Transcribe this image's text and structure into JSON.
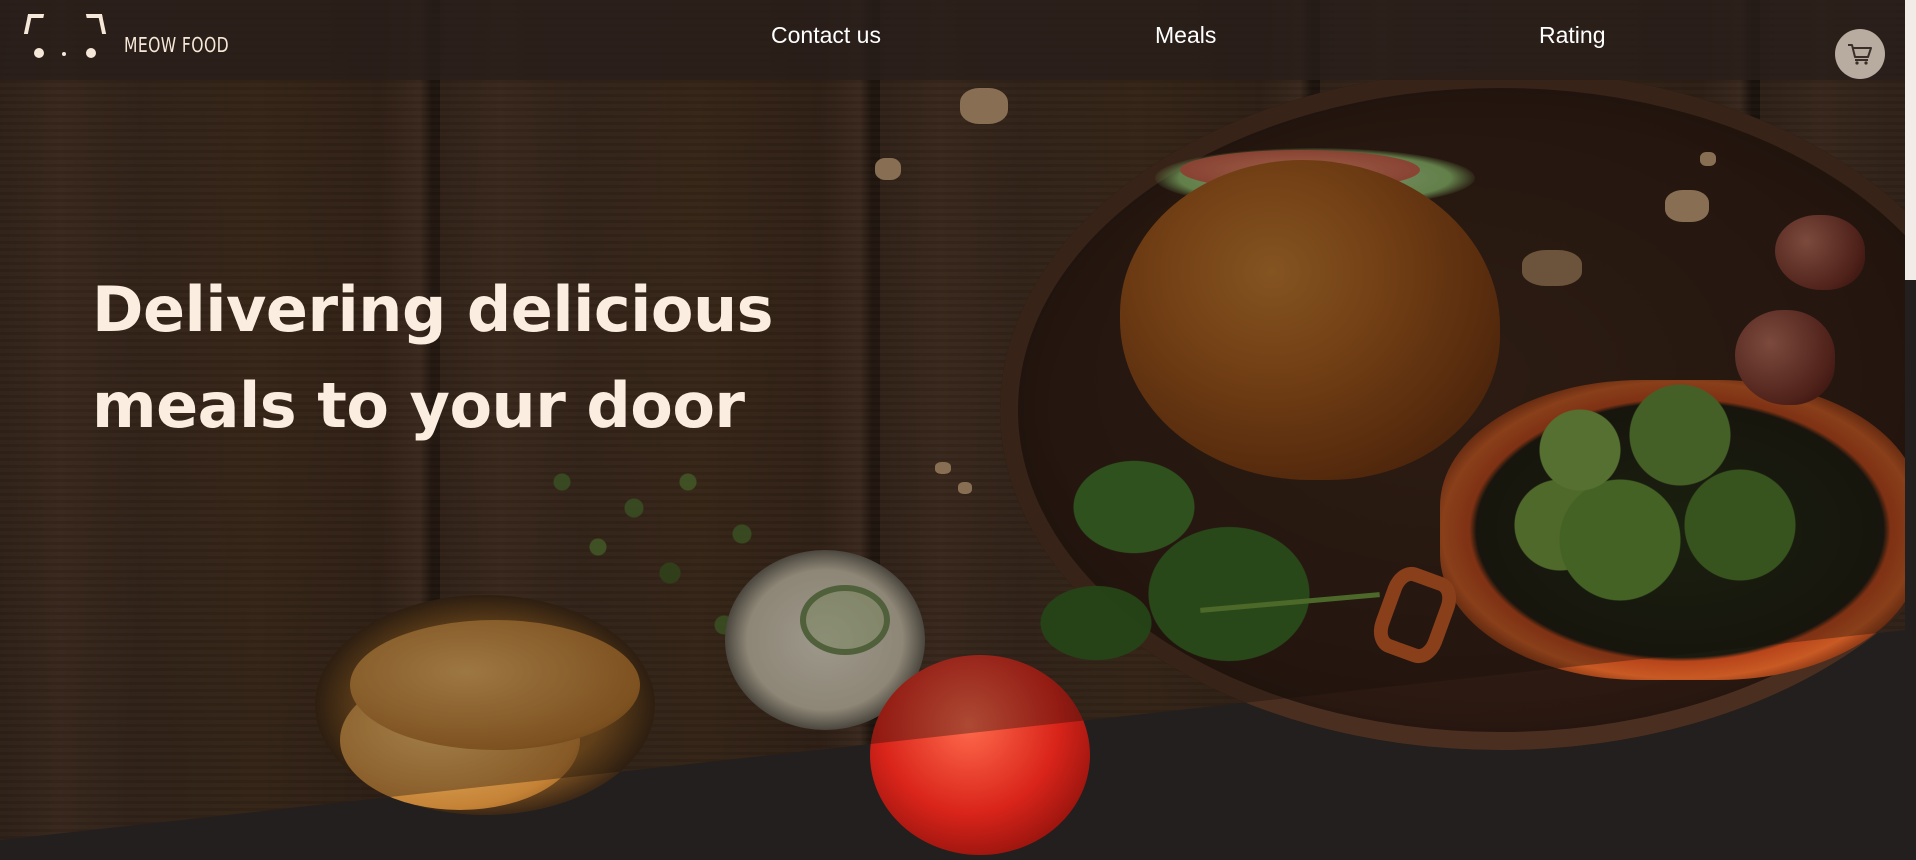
{
  "brand": {
    "name": "MEOW FOOD",
    "icon": "cat-face-icon"
  },
  "nav": {
    "items": [
      {
        "label": "Contact us"
      },
      {
        "label": "Meals"
      },
      {
        "label": "Rating"
      }
    ]
  },
  "cart": {
    "icon": "shopping-cart-icon"
  },
  "hero": {
    "headline_line1": "Delivering delicious",
    "headline_line2": "meals to your door"
  },
  "colors": {
    "header_bg": "#281e19",
    "text_cream": "#fbeee0",
    "page_bg": "#221f1e",
    "cart_bg": "#b8aba0"
  }
}
